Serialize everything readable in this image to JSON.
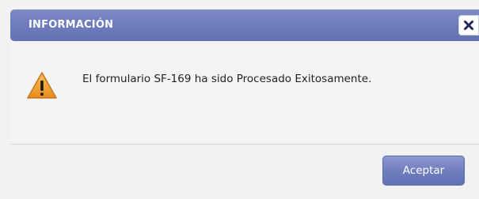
{
  "dialog": {
    "title": "INFORMACIÓN",
    "close_icon": "close-icon",
    "message_icon": "warning-icon",
    "message": "El formulario SF-169 ha sido Procesado Exitosamente.",
    "accept_label": "Aceptar"
  },
  "colors": {
    "titlebar": "#6f7cbd",
    "button": "#6f7cbd",
    "warning": "#f0a030",
    "background": "#f2f2f2"
  }
}
